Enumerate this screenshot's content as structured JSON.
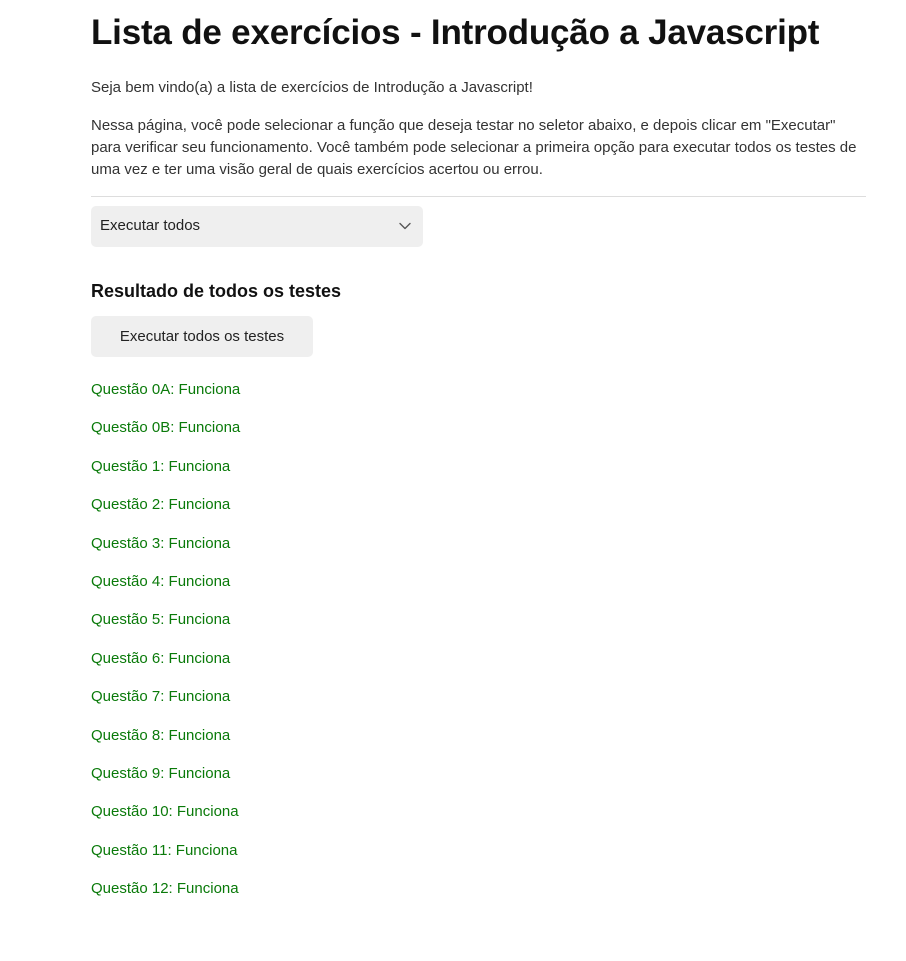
{
  "header": {
    "title": "Lista de exercícios - Introdução a Javascript"
  },
  "intro": {
    "welcome": "Seja bem vindo(a) a lista de exercícios de Introdução a Javascript!",
    "description": "Nessa página, você pode selecionar a função que deseja testar no seletor abaixo, e depois clicar em \"Executar\" para verificar seu funcionamento. Você também pode selecionar a primeira opção para executar todos os testes de uma vez e ter uma visão geral de quais exercícios acertou ou errou."
  },
  "selector": {
    "selected": "Executar todos",
    "icon": "chevron-down-icon"
  },
  "results_section": {
    "title": "Resultado de todos os testes",
    "run_button_label": "Executar todos os testes",
    "success_color": "#0a7a0a",
    "items": [
      "Questão 0A: Funciona",
      "Questão 0B: Funciona",
      "Questão 1: Funciona",
      "Questão 2: Funciona",
      "Questão 3: Funciona",
      "Questão 4: Funciona",
      "Questão 5: Funciona",
      "Questão 6: Funciona",
      "Questão 7: Funciona",
      "Questão 8: Funciona",
      "Questão 9: Funciona",
      "Questão 10: Funciona",
      "Questão 11: Funciona",
      "Questão 12: Funciona"
    ]
  }
}
